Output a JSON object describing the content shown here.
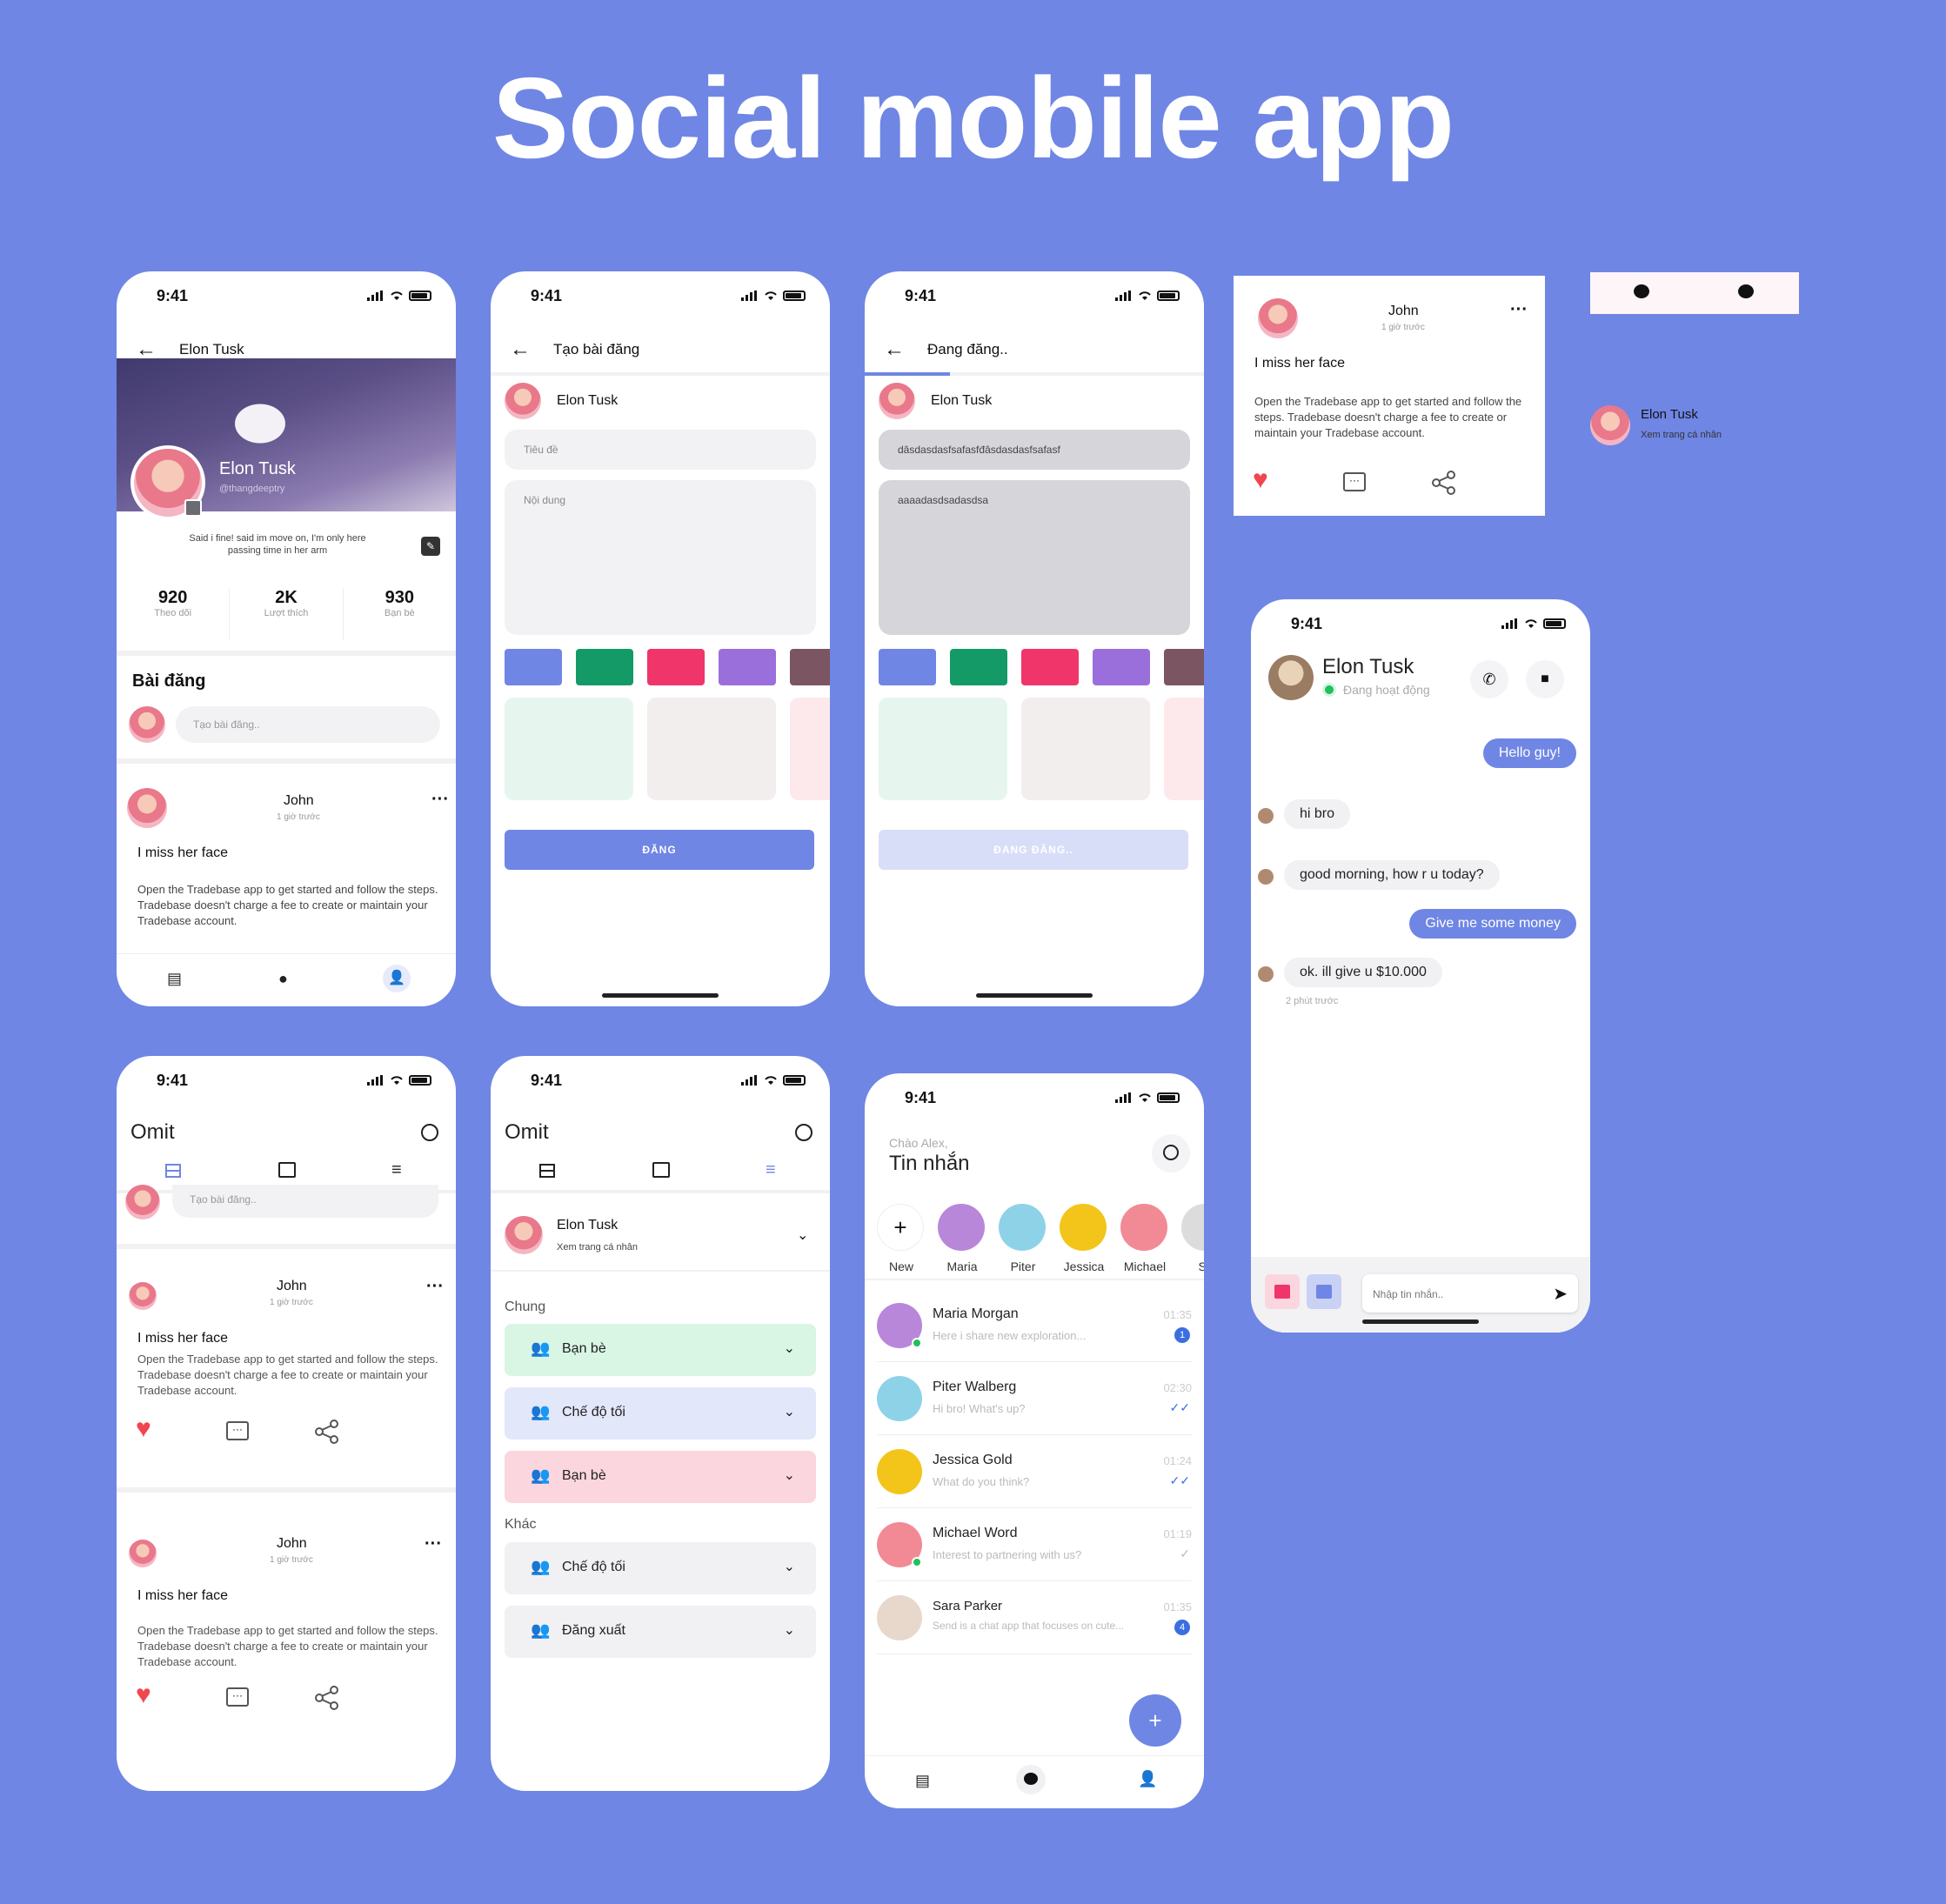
{
  "page": {
    "title": "Social mobile app"
  },
  "status": {
    "time": "9:41"
  },
  "profile": {
    "header_title": "Elon Tusk",
    "name": "Elon Tusk",
    "handle": "@thangdeeptry",
    "bio": "Said i fine! said im move on, I'm only here passing time in her arm",
    "stats": [
      {
        "value": "920",
        "label": "Theo dõi"
      },
      {
        "value": "2K",
        "label": "Lượt thích"
      },
      {
        "value": "930",
        "label": "Bạn bè"
      }
    ],
    "section_title": "Bài đăng",
    "create_placeholder": "Tạo bài đăng.."
  },
  "post": {
    "author": "John",
    "time": "1 giờ trước",
    "title": "I miss her face",
    "body": "Open the Tradebase app to get started and follow the steps. Tradebase doesn't charge a fee to create or maintain your Tradebase account."
  },
  "create": {
    "header_title": "Tạo bài đăng",
    "user": "Elon Tusk",
    "title_placeholder": "Tiêu đề",
    "content_placeholder": "Nội dung",
    "button": "ĐĂNG",
    "swatch_colors": [
      "#6f86e4",
      "#149a67",
      "#f0356a",
      "#9b6fdb",
      "#7b5562"
    ],
    "tile_colors": [
      "#e6f6ee",
      "#f3eeee",
      "#fde8ec"
    ]
  },
  "posting": {
    "header_title": "Đang đăng..",
    "user": "Elon Tusk",
    "title_value": "dâsdasdasfsafasfđâsdasdasfsafasf",
    "content_value": "aaaadasdsadasdsa",
    "button": "ĐANG ĐĂNG.."
  },
  "post_card": {
    "author": "John",
    "time": "1 giờ trước",
    "title": "I miss her face",
    "body": "Open the Tradebase app to get started and follow the steps. Tradebase doesn't charge a fee to create or maintain your Tradebase account."
  },
  "mini_profile": {
    "name": "Elon Tusk",
    "sub": "Xem trang cá nhân"
  },
  "chat": {
    "name": "Elon Tusk",
    "status": "Đang hoạt động",
    "messages": [
      {
        "dir": "out",
        "text": "Hello guy!"
      },
      {
        "dir": "in",
        "text": "hi bro"
      },
      {
        "dir": "in",
        "text": "good morning, how r u today?"
      },
      {
        "dir": "out",
        "text": "Give me some money"
      },
      {
        "dir": "in",
        "text": "ok. ill give u $10.000"
      }
    ],
    "time_note": "2 phút trước",
    "input_placeholder": "Nhập tin nhắn.."
  },
  "feed": {
    "app_title": "Omit",
    "create_placeholder": "Tạo bài đăng.."
  },
  "menu": {
    "app_title": "Omit",
    "user": "Elon Tusk",
    "user_sub": "Xem trang cá nhân",
    "section_general": "Chung",
    "section_other": "Khác",
    "items_general": [
      {
        "label": "Bạn bè",
        "bg": "#d9f5e4"
      },
      {
        "label": "Chế độ tối",
        "bg": "#e3e7fa"
      },
      {
        "label": "Bạn bè",
        "bg": "#fbd6df"
      }
    ],
    "items_other": [
      {
        "label": "Chế độ tối",
        "bg": "#f1f1f3"
      },
      {
        "label": "Đăng xuất",
        "bg": "#f1f1f3"
      }
    ]
  },
  "messages": {
    "greeting": "Chào Alex,",
    "title": "Tin nhắn",
    "stories": [
      {
        "name": "New"
      },
      {
        "name": "Maria",
        "color": "#b887d9"
      },
      {
        "name": "Piter",
        "color": "#8ed2e8"
      },
      {
        "name": "Jessica",
        "color": "#f3c51a"
      },
      {
        "name": "Michael",
        "color": "#f28a95"
      },
      {
        "name": "Sa",
        "color": "#dcdcdc"
      }
    ],
    "conversations": [
      {
        "name": "Maria Morgan",
        "preview": "Here i share new exploration...",
        "time": "01:35",
        "badge": "1",
        "color": "#b887d9"
      },
      {
        "name": "Piter Walberg",
        "preview": "Hi bro! What's up?",
        "time": "02:30",
        "badge": "",
        "color": "#8ed2e8"
      },
      {
        "name": "Jessica Gold",
        "preview": "What do you think?",
        "time": "01:24",
        "badge": "",
        "color": "#f3c51a"
      },
      {
        "name": "Michael Word",
        "preview": "Interest to partnering with us?",
        "time": "01:19",
        "badge": "",
        "color": "#f28a95"
      },
      {
        "name": "Sara Parker",
        "preview": "Send is a chat app that focuses on cute...",
        "time": "01:35",
        "badge": "4",
        "color": "#e8d8cc"
      }
    ]
  }
}
